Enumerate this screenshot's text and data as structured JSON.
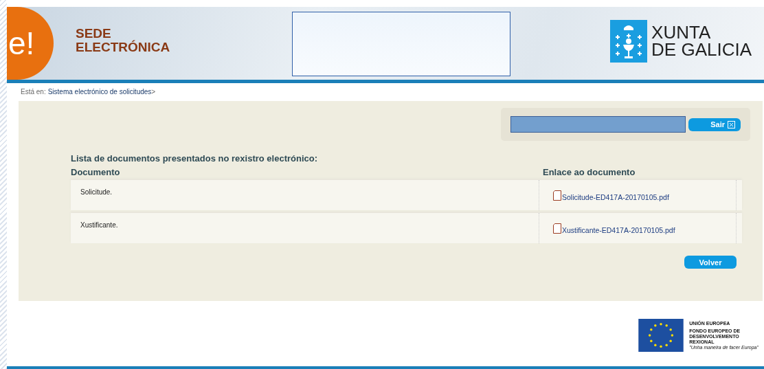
{
  "header": {
    "logo_mark": "e!",
    "title_lines": [
      "SEDE",
      "ELECTRÓNICA"
    ],
    "gov_lines": [
      "XUNTA",
      "DE GALICIA"
    ]
  },
  "breadcrumb": {
    "prefix": "Está en:",
    "link": "Sistema electrónico de solicitudes",
    "separator": ">"
  },
  "user_bar": {
    "logout_button": "Sair"
  },
  "documents": {
    "title": "Lista de documentos presentados no rexistro electrónico:",
    "columns": [
      "Documento",
      "Enlace ao documento"
    ],
    "rows": [
      {
        "document": "Solicitude.",
        "file": "Solicitude-ED417A-20170105.pdf"
      },
      {
        "document": "Xustificante.",
        "file": "Xustificante-ED417A-20170105.pdf"
      }
    ]
  },
  "back_button": "Volver",
  "footer": {
    "eu_title": "UNIÓN EUROPEA",
    "fund_lines": [
      "FONDO EUROPEO DE",
      "DESENVOLVEMENTO",
      "REXIONAL"
    ],
    "motto": "\"Unha maneira de facer Europa\""
  }
}
